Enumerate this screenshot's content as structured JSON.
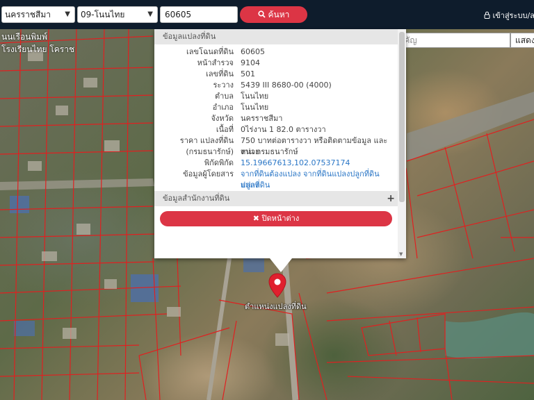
{
  "topbar": {
    "province": "นครราชสีมา",
    "district": "09-โนนไทย",
    "parcel_input": "60605",
    "search_button": "ค้นหา",
    "login": "เข้าสู่ระบบ/ล"
  },
  "place_search": {
    "placeholder": "ค้นหาสถานที่สำคัญ",
    "show_button": "แสดง"
  },
  "panel": {
    "section_parcel": "ข้อมูลแปลงที่ดิน",
    "rows": [
      {
        "label": "เลขโฉนดที่ดิน",
        "value": "60605"
      },
      {
        "label": "หน้าสำรวจ",
        "value": "9104"
      },
      {
        "label": "เลขที่ดิน",
        "value": "501"
      },
      {
        "label": "ระวาง",
        "value": "5439 III 8680-00 (4000)"
      },
      {
        "label": "ตำบล",
        "value": "โนนไทย"
      },
      {
        "label": "อำเภอ",
        "value": "โนนไทย"
      },
      {
        "label": "จังหวัด",
        "value": "นครราชสีมา"
      },
      {
        "label": "เนื้อที่",
        "value": "0ไร่งาน 1 82.0 ตารางวา"
      },
      {
        "label": "ราคา แปลงที่ดิน",
        "label2": "(กรมธนารักษ์)",
        "value": "750 บาทต่อตารางวา หรือติดตามข้อมูล และหน่วย",
        "value2": "งาน กรมธนารักษ์"
      },
      {
        "label": "พิกัดพิกัด",
        "value": "15.19667613,102.07537174"
      },
      {
        "label": "ข้อมูลผู้โดยสาร",
        "value": "จากที่ดินต้องแปลง จากที่ดินแปลงปลูกที่ดินแปลง",
        "value2": "ปลูกที่ดิน"
      }
    ],
    "section_office": "ข้อมูลสำนักงานที่ดิน",
    "close_button": "ปิดหน้าต่าง"
  },
  "map": {
    "pin_label": "ตำแหน่งแปลงที่ดิน",
    "place_label_1": "นนเรือนพิมพ์",
    "place_label_2": "โรงเรียนไทย โคราช"
  },
  "colors": {
    "topbar": "#0e1c2c",
    "accent_red": "#dc3545",
    "parcel_line": "#e02020",
    "link": "#2a76c6"
  }
}
